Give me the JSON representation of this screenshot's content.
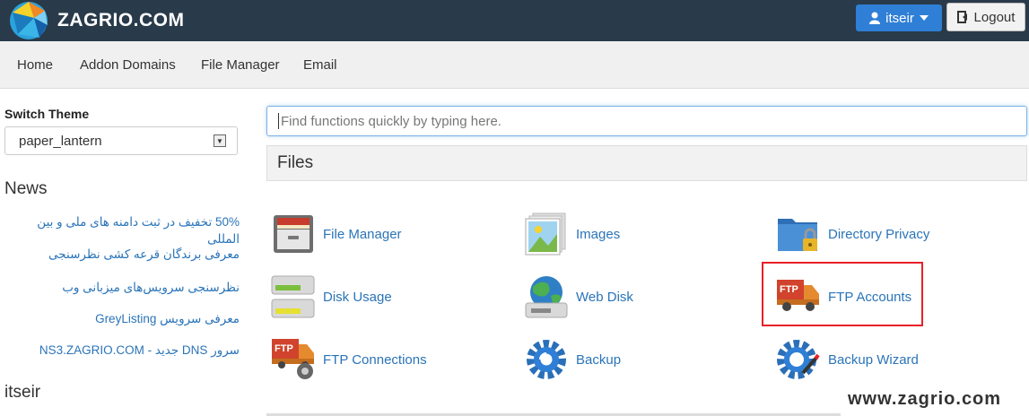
{
  "brand": {
    "name": "ZAGRIO.COM"
  },
  "header": {
    "user_label": "itseir",
    "logout_label": "Logout"
  },
  "nav": {
    "items": [
      "Home",
      "Addon Domains",
      "File Manager",
      "Email"
    ]
  },
  "sidebar": {
    "switch_theme_label": "Switch Theme",
    "theme_value": "paper_lantern",
    "news_title": "News",
    "news_items": [
      "50% تخفیف در ثبت دامنه های ملی و بین المللی",
      "معرفی برندگان قرعه کشی نظرسنجی",
      "نظرسنجی سرویس‌های میزبانی وب",
      "معرفی سرویس GreyListing",
      "سرور DNS جدید - NS3.ZAGRIO.COM"
    ],
    "username": "itseir"
  },
  "search": {
    "placeholder": "Find functions quickly by typing here."
  },
  "files_panel": {
    "title": "Files",
    "items": [
      {
        "label": "File Manager",
        "icon": "file-manager-icon"
      },
      {
        "label": "Images",
        "icon": "images-icon"
      },
      {
        "label": "Directory Privacy",
        "icon": "directory-privacy-icon"
      },
      {
        "label": "Disk Usage",
        "icon": "disk-usage-icon"
      },
      {
        "label": "Web Disk",
        "icon": "web-disk-icon"
      },
      {
        "label": "FTP Accounts",
        "icon": "ftp-accounts-icon"
      },
      {
        "label": "FTP Connections",
        "icon": "ftp-connections-icon"
      },
      {
        "label": "Backup",
        "icon": "backup-icon"
      },
      {
        "label": "Backup Wizard",
        "icon": "backup-wizard-icon"
      }
    ]
  },
  "watermark": "www.zagrio.com",
  "colors": {
    "topbar": "#293a4a",
    "link": "#2a74b8",
    "primary_button": "#2f7fd6",
    "highlight": "#e8202a"
  }
}
